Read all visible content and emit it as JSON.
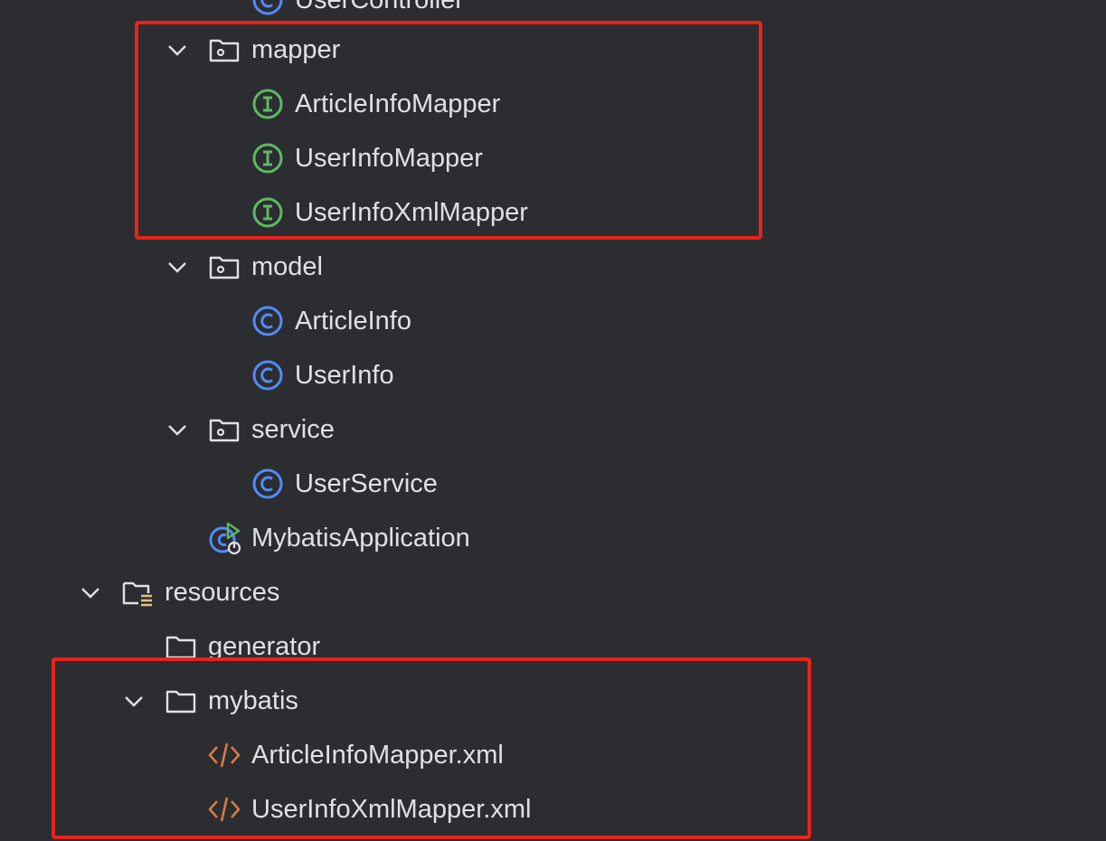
{
  "tree": {
    "controller_child": "UserController",
    "mapper": {
      "label": "mapper",
      "children": [
        "ArticleInfoMapper",
        "UserInfoMapper",
        "UserInfoXmlMapper"
      ]
    },
    "model": {
      "label": "model",
      "children": [
        "ArticleInfo",
        "UserInfo"
      ]
    },
    "service": {
      "label": "service",
      "children": [
        "UserService"
      ]
    },
    "app_class": "MybatisApplication",
    "resources": {
      "label": "resources",
      "generator": "generator",
      "mybatis": {
        "label": "mybatis",
        "children": [
          "ArticleInfoMapper.xml",
          "UserInfoXmlMapper.xml"
        ]
      }
    }
  },
  "colors": {
    "background": "#2b2d30",
    "text": "#dfe1e5",
    "class_icon": "#548af7",
    "interface_icon": "#5fb865",
    "xml_icon": "#d97a45",
    "run_icon": "#5fb865",
    "resources_icon": "#e5c07b",
    "highlight": "#e8231c"
  }
}
